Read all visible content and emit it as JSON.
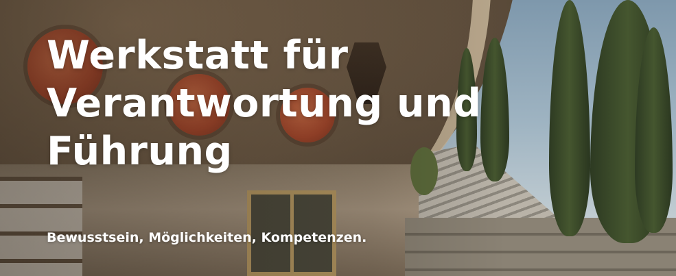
{
  "hero": {
    "title_lines": [
      "Werkstatt für",
      "Verantwortung und",
      "Führung"
    ],
    "subtitle": "Bewusstsein, Möglichkeiten, Kompetenzen."
  },
  "colors": {
    "text": "#ffffff",
    "sky": "#9fb4c2",
    "vault": "#6e5b46",
    "accent_disc": "#a8482c",
    "cypress": "#45562f"
  }
}
